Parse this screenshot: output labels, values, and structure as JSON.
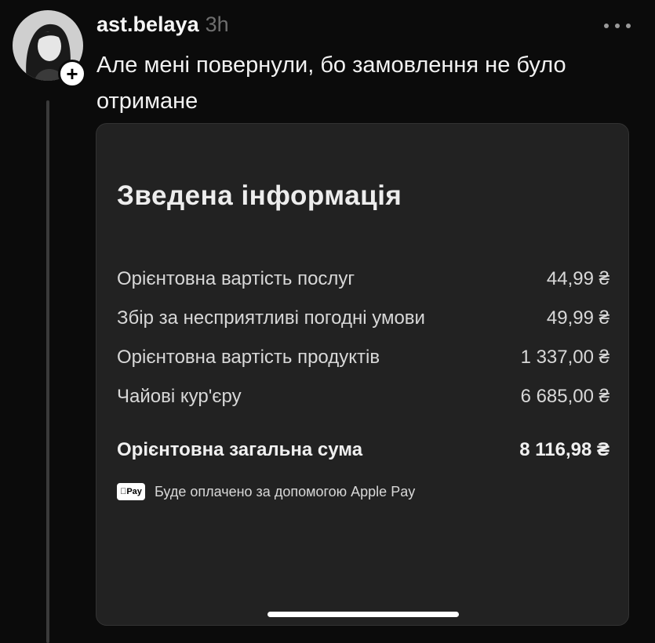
{
  "post": {
    "username": "ast.belaya",
    "time": "3h",
    "text": "Але мені повернули, бо замовлення не було отримане"
  },
  "icons": {
    "follow": "plus-icon",
    "more": "more-dots-icon",
    "payment": "apple-pay-icon"
  },
  "card": {
    "title": "Зведена інформація",
    "rows": [
      {
        "label": "Орієнтовна вартість послуг",
        "value": "44,99 ₴"
      },
      {
        "label": "Збір за несприятливі погодні умови",
        "value": "49,99 ₴"
      },
      {
        "label": "Орієнтовна вартість продуктів",
        "value": "1 337,00 ₴"
      },
      {
        "label": "Чайові кур'єру",
        "value": "6 685,00 ₴"
      }
    ],
    "total": {
      "label": "Орієнтовна загальна сума",
      "value": "8 116,98 ₴"
    },
    "payment_badge": "Pay",
    "payment_text": "Буде оплачено за допомогою Apple Pay"
  },
  "colors": {
    "background": "#0b0b0b",
    "card": "#222222",
    "text": "#f2f2f2",
    "muted": "#6e6e6e"
  }
}
